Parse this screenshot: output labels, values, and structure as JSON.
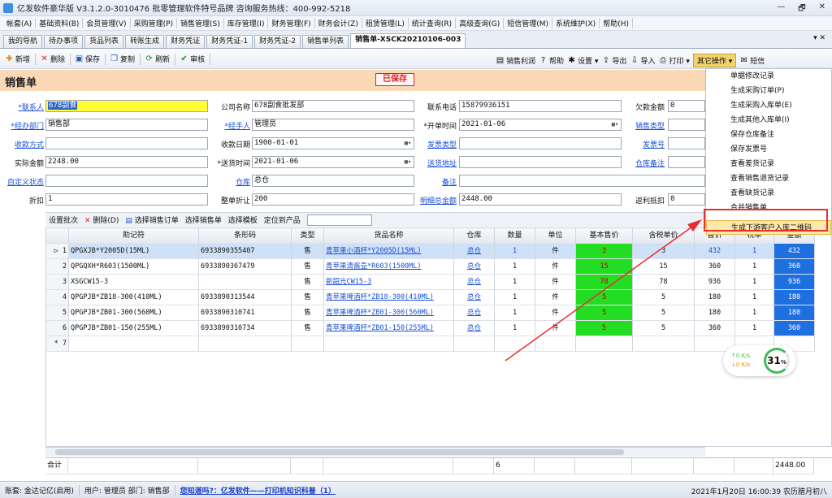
{
  "window": {
    "title": "亿发软件豪华版 V3.1.2.0-3010476 批零管理软件特号品牌 咨询服务热线：400-992-5218",
    "controls": [
      "—",
      "🗗",
      "✕"
    ]
  },
  "menubar": [
    "帐套(A)",
    "基础资料(B)",
    "会员管理(V)",
    "采购管理(P)",
    "销售管理(S)",
    "库存管理(I)",
    "财务管理(F)",
    "财务会计(Z)",
    "租赁管理(L)",
    "统计查询(R)",
    "高级查询(G)",
    "短信管理(M)",
    "系统维护(X)",
    "帮助(H)"
  ],
  "tabs": [
    "我的导航",
    "待办事项",
    "货品列表",
    "转账生成",
    "财务凭证",
    "财务凭证-1",
    "财务凭证-2",
    "销售单列表",
    "销售单-XSCK20210106-003"
  ],
  "tabs_close": "▾ ✕",
  "toolbar": {
    "left": [
      {
        "label": "新增",
        "icon": "plus-icon",
        "glyph": "✚",
        "color": "#e08a00"
      },
      {
        "label": "删除",
        "icon": "delete-icon",
        "glyph": "✕",
        "color": "#d22"
      },
      {
        "label": "保存",
        "icon": "save-icon",
        "glyph": "▣",
        "color": "#2a5cb8"
      },
      {
        "label": "复制",
        "icon": "copy-icon",
        "glyph": "❐",
        "color": "#2a5cb8"
      },
      {
        "label": "刷新",
        "icon": "refresh-icon",
        "glyph": "⟳",
        "color": "#2a8a2a"
      },
      {
        "label": "审核",
        "icon": "check-icon",
        "glyph": "✔",
        "color": "#2a8a2a"
      }
    ],
    "right": [
      {
        "label": "销售利润",
        "icon": "chart-icon",
        "glyph": "▤"
      },
      {
        "label": "帮助",
        "icon": "help-icon",
        "glyph": "?"
      },
      {
        "label": "设置 ▾",
        "icon": "settings-icon",
        "glyph": "✱"
      },
      {
        "label": "导出",
        "icon": "export-icon",
        "glyph": "⇪"
      },
      {
        "label": "导入",
        "icon": "import-icon",
        "glyph": "⇩"
      },
      {
        "label": "打印 ▾",
        "icon": "print-icon",
        "glyph": "⎙"
      },
      {
        "label": "其它操作 ▾",
        "icon": "",
        "glyph": ""
      },
      {
        "label": "短信",
        "icon": "sms-icon",
        "glyph": "✉"
      }
    ]
  },
  "page": {
    "title": "销售单",
    "stamp": "已保存"
  },
  "form": {
    "contact_label": "*联系人",
    "contact_value": "678副食",
    "company_label": "公司名称",
    "company_value": "678副食批发部",
    "phone_label": "联系电话",
    "phone_value": "15879936151",
    "owed_label": "欠款金额",
    "owed_value": "0",
    "dept_label": "*经办部门",
    "dept_value": "销售部",
    "handler_label": "*经手人",
    "handler_value": "管理员",
    "opendate_label": "*开单时间",
    "opendate_value": "2021-01-06",
    "saletype_label": "销售类型",
    "paymethod_label": "收款方式",
    "paydate_label": "收款日期",
    "paydate_value": "1900-01-01",
    "invtype_label": "发票类型",
    "invno_label": "发票号",
    "actual_label": "实际金额",
    "actual_value": "2248.00",
    "shipdate_label": "*送货时间",
    "shipdate_value": "2021-01-06",
    "shipaddr_label": "送货地址",
    "wnote_label": "仓库备注",
    "custom_label": "自定义状态",
    "warehouse_label": "仓库",
    "warehouse_value": "总仓",
    "note_label": "备注",
    "discount_label": "折扣",
    "discount_value": "1",
    "wholediscount_label": "整单折让",
    "wholediscount_value": "200",
    "detailtotal_label": "明细总金额",
    "detailtotal_value": "2448.00",
    "rebate_label": "返利抵扣",
    "rebate_value": "0"
  },
  "subbar": [
    "设置批次",
    "删除(D)",
    "选择销售订单",
    "选择销售单",
    "选择模板",
    "定位到产品"
  ],
  "grid": {
    "headers": [
      "助记符",
      "条形码",
      "类型",
      "货品名称",
      "仓库",
      "数量",
      "单位",
      "基本售价",
      "含税单价",
      "售价",
      "税率",
      "金额"
    ],
    "rows": [
      {
        "no": "1",
        "code": "QPGXJB*Y2005D(15ML)",
        "barcode": "6933890355407",
        "type": "售",
        "name": "青苹果小酒杯*Y2005D(15ML)",
        "wh": "总仓",
        "qty": "1",
        "unit": "件",
        "base": "3",
        "taxprice": "3",
        "price": "432",
        "tax": "1",
        "amount": "432"
      },
      {
        "no": "2",
        "code": "QPGQXH*R603(1500ML)",
        "barcode": "6933890367479",
        "type": "售",
        "name": "青苹果清酱壶*R603(1500ML)",
        "wh": "总仓",
        "qty": "1",
        "unit": "件",
        "base": "15",
        "taxprice": "15",
        "price": "360",
        "tax": "1",
        "amount": "360"
      },
      {
        "no": "3",
        "code": "XSGCW15-3",
        "barcode": "",
        "type": "售",
        "name": "新韶光CW15-3",
        "wh": "总仓",
        "qty": "1",
        "unit": "件",
        "base": "78",
        "taxprice": "78",
        "price": "936",
        "tax": "1",
        "amount": "936"
      },
      {
        "no": "4",
        "code": "QPGPJB*ZB18-300(410ML)",
        "barcode": "6933890313544",
        "type": "售",
        "name": "青苹果啤酒杯*ZB18-300(410ML)",
        "wh": "总仓",
        "qty": "1",
        "unit": "件",
        "base": "5",
        "taxprice": "5",
        "price": "180",
        "tax": "1",
        "amount": "180"
      },
      {
        "no": "5",
        "code": "QPGPJB*ZB01-300(560ML)",
        "barcode": "6933890310741",
        "type": "售",
        "name": "青苹果啤酒杯*ZB01-300(560ML)",
        "wh": "总仓",
        "qty": "1",
        "unit": "件",
        "base": "5",
        "taxprice": "5",
        "price": "180",
        "tax": "1",
        "amount": "180"
      },
      {
        "no": "6",
        "code": "QPGPJB*ZB01-150(255ML)",
        "barcode": "6933890310734",
        "type": "售",
        "name": "青苹果啤酒杯*ZB01-150(255ML)",
        "wh": "总仓",
        "qty": "1",
        "unit": "件",
        "base": "5",
        "taxprice": "5",
        "price": "360",
        "tax": "1",
        "amount": "360"
      }
    ],
    "new_row_no": "* 7",
    "sum_label": "合计",
    "sum_qty": "6",
    "sum_amount": "2448.00"
  },
  "context_menu": [
    "单据修改记录",
    "生成采购订单(P)",
    "生成采购入库单(E)",
    "生成其他入库单(I)",
    "保存仓库备注",
    "保存发票号",
    "查看差货记录",
    "查看销售退货记录",
    "查看缺货记录",
    "合并销售单",
    "生成下游客户入库二维码"
  ],
  "net_widget": {
    "up": "↑0  K/s",
    "down": "↓0  K/s",
    "percent": "31",
    "unit": "%"
  },
  "status": {
    "account": "账套: 金达记亿(启用)",
    "user": "用户: 管理员  部门: 销售部",
    "news": "您知道吗?：亿发软件——打印机知识科普（1）",
    "clock": "2021年1月20日 16:00:39 农历腊月初八"
  },
  "colors": {
    "accent": "#f3d36b",
    "highlight_box": "#e53030",
    "link": "#1a4fd6"
  }
}
